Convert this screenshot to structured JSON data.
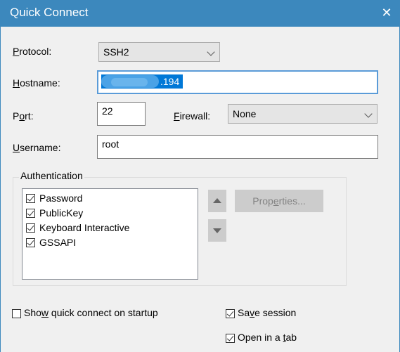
{
  "window": {
    "title": "Quick Connect",
    "close_label": "✕"
  },
  "form": {
    "protocol": {
      "label_pre": "",
      "label_key": "P",
      "label_post": "rotocol:",
      "value": "SSH2"
    },
    "hostname": {
      "label_pre": "",
      "label_key": "H",
      "label_post": "ostname:",
      "value_visible": ".194"
    },
    "port": {
      "label_pre": "P",
      "label_key": "o",
      "label_post": "rt:",
      "value": "22"
    },
    "firewall": {
      "label_pre": "",
      "label_key": "F",
      "label_post": "irewall:",
      "value": "None"
    },
    "username": {
      "label_pre": "",
      "label_key": "U",
      "label_post": "sername:",
      "value": "root"
    }
  },
  "authentication": {
    "group_label": "Authentication",
    "methods": [
      {
        "label": "Password",
        "checked": true
      },
      {
        "label": "PublicKey",
        "checked": true
      },
      {
        "label": "Keyboard Interactive",
        "checked": true
      },
      {
        "label": "GSSAPI",
        "checked": true
      }
    ],
    "properties_button": {
      "pre": "Prop",
      "key": "e",
      "post": "rties..."
    }
  },
  "options": {
    "show_on_startup": {
      "pre": "Sho",
      "key": "w",
      "post": " quick connect on startup",
      "checked": false
    },
    "save_session": {
      "pre": "Sa",
      "key": "v",
      "post": "e session",
      "checked": true
    },
    "open_in_tab": {
      "pre": "Open in a ",
      "key": "t",
      "post": "ab",
      "checked": true
    }
  },
  "colors": {
    "titlebar": "#3c88bd",
    "selection": "#0078d7",
    "focus_border": "#5a9bd8"
  }
}
